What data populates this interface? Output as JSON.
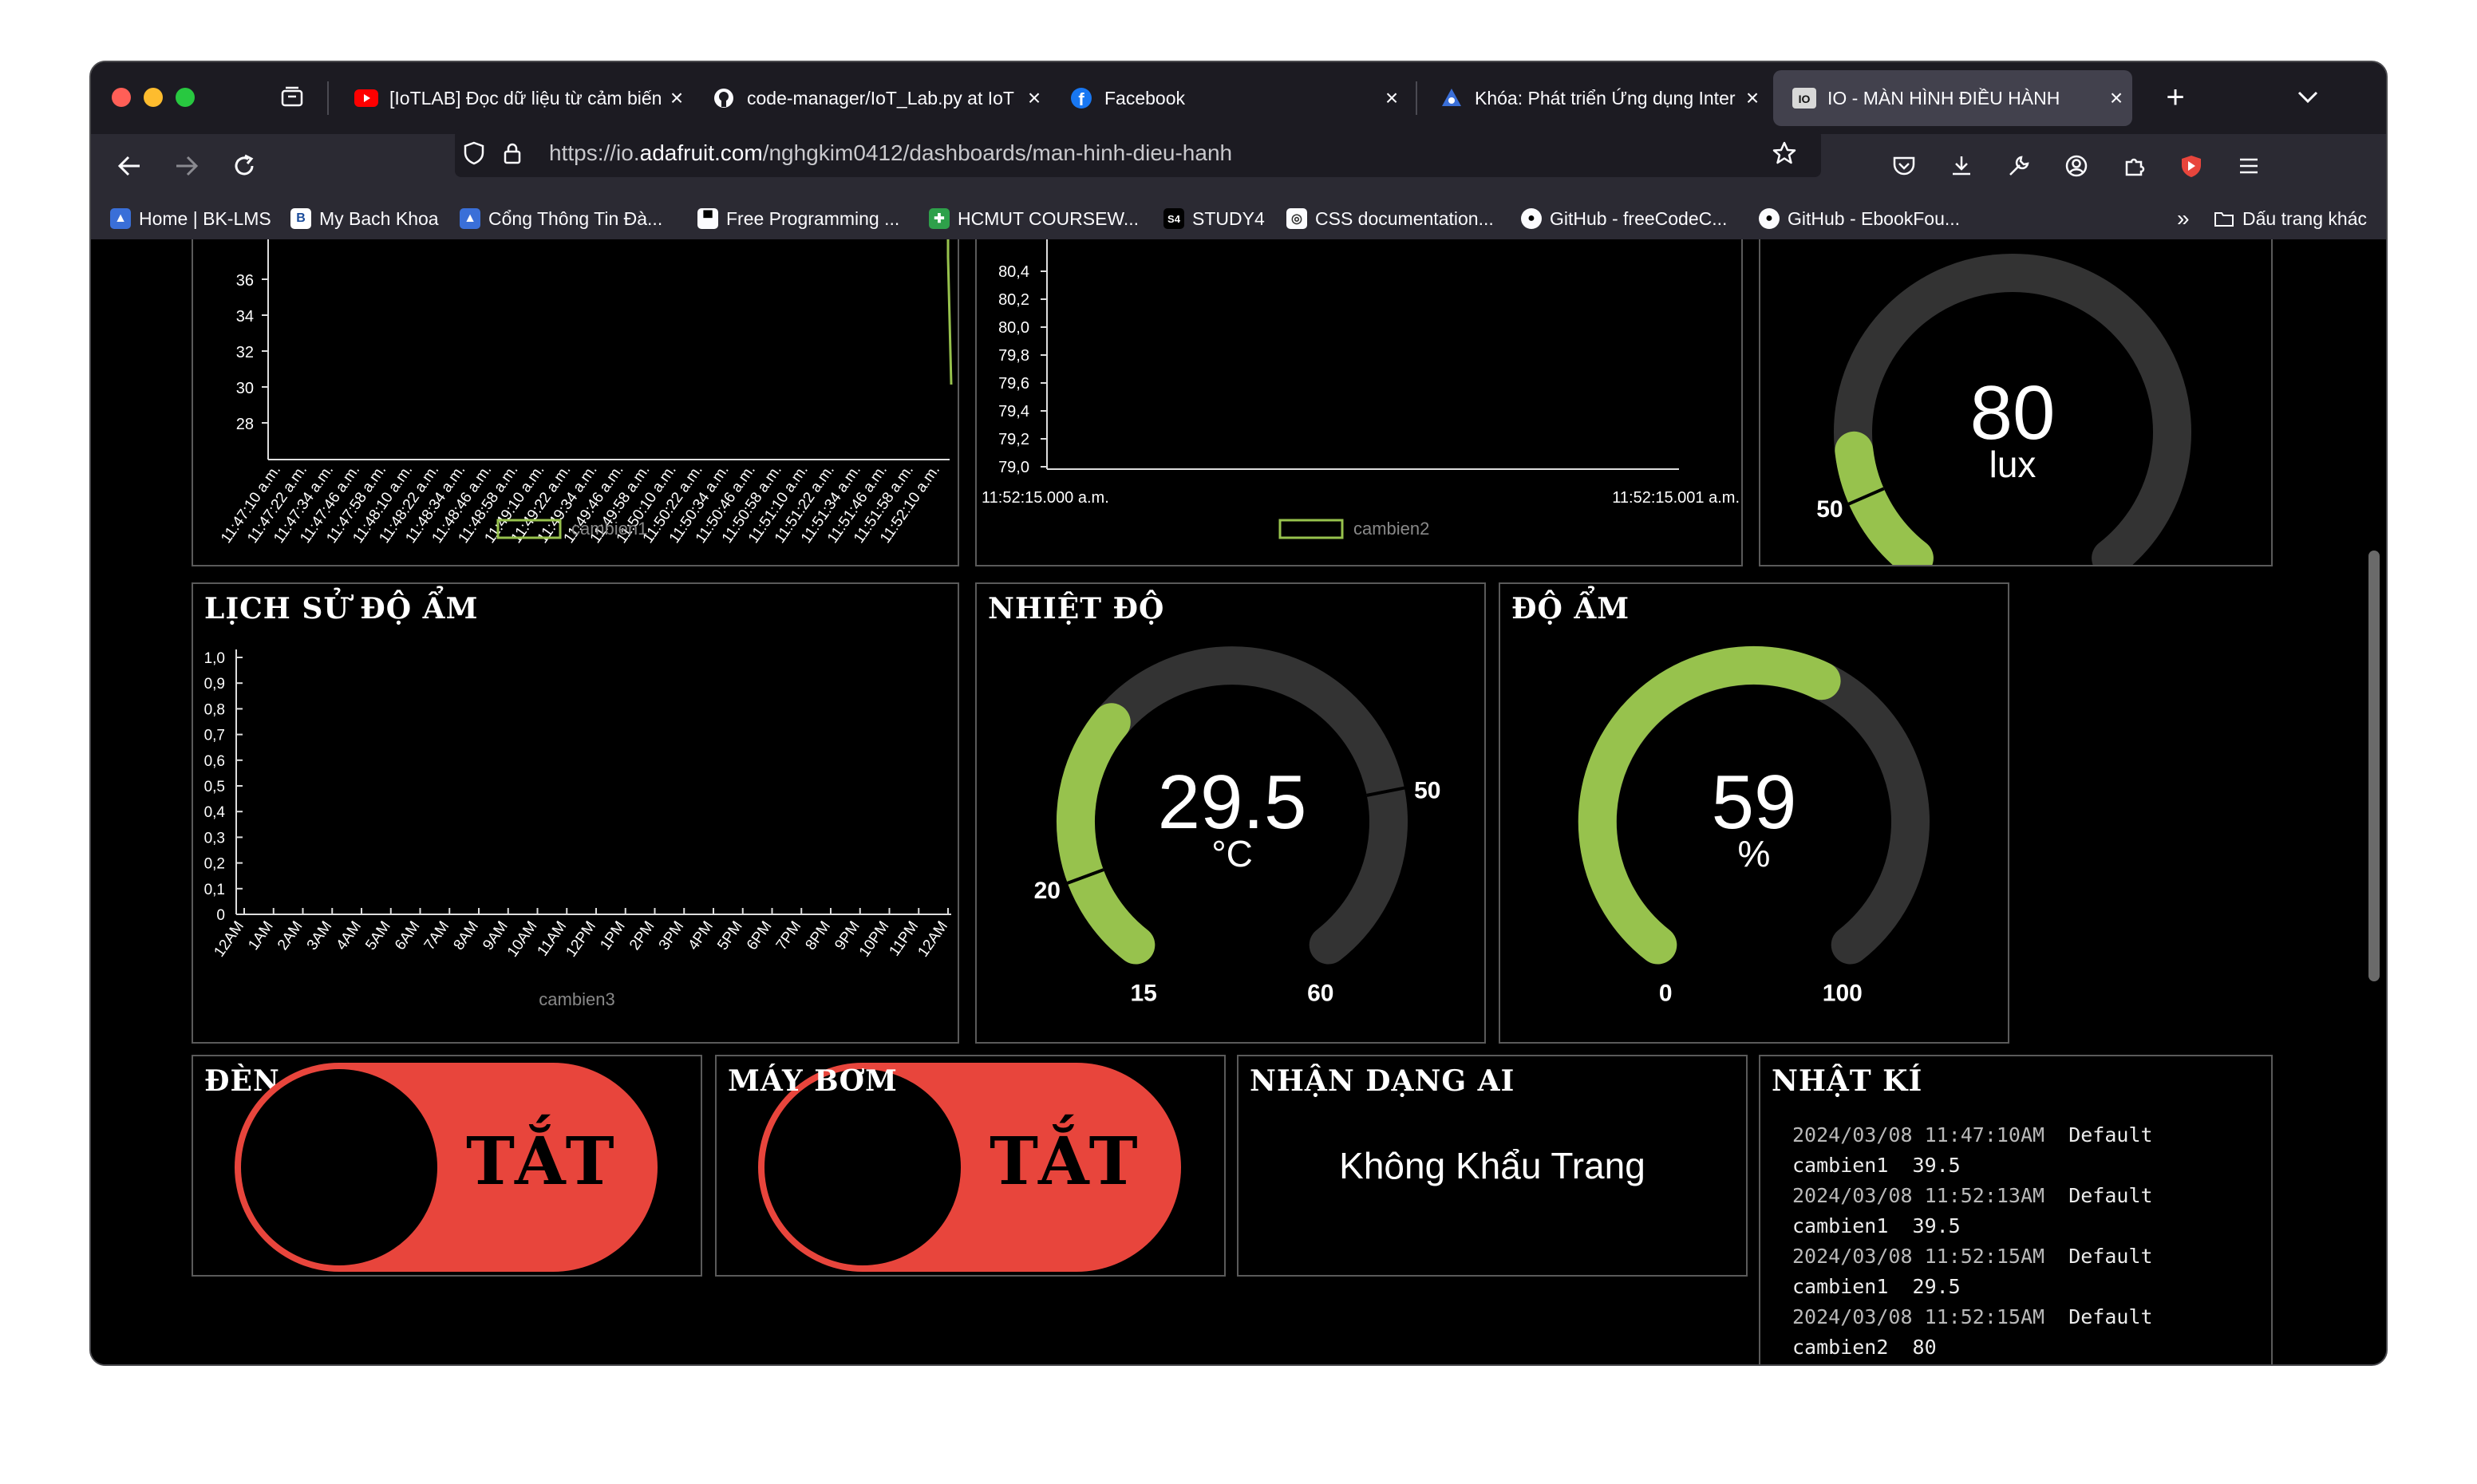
{
  "browser": {
    "tabs": [
      {
        "title": "[IoTLAB] Đọc dữ liệu từ cảm biến",
        "icon": "youtube-icon"
      },
      {
        "title": "code-manager/IoT_Lab.py at IoT",
        "icon": "github-icon"
      },
      {
        "title": "Facebook",
        "icon": "facebook-icon"
      },
      {
        "title": "Khóa: Phát triển Ứng dụng Internet",
        "icon": "bk-icon"
      },
      {
        "title": "IO - MÀN HÌNH ĐIỀU HÀNH",
        "icon": "adafruit-io-icon",
        "active": true
      }
    ],
    "url_prefix": "https://io.",
    "url_domain": "adafruit.com",
    "url_path": "/nghgkim0412/dashboards/man-hinh-dieu-hanh",
    "bookmarks": [
      "Home | BK-LMS",
      "My Bach Khoa",
      "Cổng Thông Tin Đà...",
      "Free Programming ...",
      "HCMUT COURSEW...",
      "STUDY4",
      "CSS documentation...",
      "GitHub - freeCodeC...",
      "GitHub - EbookFou..."
    ],
    "other_bookmarks": "Dấu trang khác"
  },
  "dashboard": {
    "chart1": {
      "legend": "cambien1",
      "y_ticks": [
        "36",
        "34",
        "32",
        "30",
        "28"
      ],
      "x_ticks": [
        "11:47:10 a.m.",
        "11:47:22 a.m.",
        "11:47:34 a.m.",
        "11:47:46 a.m.",
        "11:47:58 a.m.",
        "11:48:10 a.m.",
        "11:48:22 a.m.",
        "11:48:34 a.m.",
        "11:48:46 a.m.",
        "11:48:58 a.m.",
        "11:49:10 a.m.",
        "11:49:22 a.m.",
        "11:49:34 a.m.",
        "11:49:46 a.m.",
        "11:49:58 a.m.",
        "11:50:10 a.m.",
        "11:50:22 a.m.",
        "11:50:34 a.m.",
        "11:50:46 a.m.",
        "11:50:58 a.m.",
        "11:51:10 a.m.",
        "11:51:22 a.m.",
        "11:51:34 a.m.",
        "11:51:46 a.m.",
        "11:51:58 a.m.",
        "11:52:10 a.m."
      ]
    },
    "chart2": {
      "legend": "cambien2",
      "y_ticks": [
        "80,4",
        "80,2",
        "80,0",
        "79,8",
        "79,6",
        "79,4",
        "79,2",
        "79,0"
      ],
      "x_start": "11:52:15.000 a.m.",
      "x_end": "11:52:15.001 a.m."
    },
    "light_gauge": {
      "value": "80",
      "unit": "lux",
      "min": "0",
      "max": "500",
      "threshold": "50",
      "fraction": 0.16
    },
    "humidity_history": {
      "title": "LỊCH SỬ ĐỘ ẨM",
      "legend": "cambien3",
      "y_ticks": [
        "1,0",
        "0,9",
        "0,8",
        "0,7",
        "0,6",
        "0,5",
        "0,4",
        "0,3",
        "0,2",
        "0,1",
        "0"
      ],
      "x_ticks": [
        "12AM",
        "1AM",
        "2AM",
        "3AM",
        "4AM",
        "5AM",
        "6AM",
        "7AM",
        "8AM",
        "9AM",
        "10AM",
        "11AM",
        "12PM",
        "1PM",
        "2PM",
        "3PM",
        "4PM",
        "5PM",
        "6PM",
        "7PM",
        "8PM",
        "9PM",
        "10PM",
        "11PM",
        "12AM"
      ]
    },
    "temp_gauge": {
      "title": "NHIỆT ĐỘ",
      "value": "29.5",
      "unit": "°C",
      "min": "15",
      "max": "60",
      "low": "20",
      "high": "50",
      "fraction": 0.3222
    },
    "hum_gauge": {
      "title": "ĐỘ ẨM",
      "value": "59",
      "unit": "%",
      "min": "0",
      "max": "100",
      "fraction": 0.59
    },
    "toggle_light": {
      "title": "ĐÈN",
      "state": "TẮT"
    },
    "toggle_pump": {
      "title": "MÁY BƠM",
      "state": "TẮT"
    },
    "ai": {
      "title": "NHẬN DẠNG AI",
      "text": "Không Khẩu Trang"
    },
    "log": {
      "title": "NHẬT KÍ",
      "entries": [
        {
          "time": "2024/03/08 11:47:10AM",
          "group": "Default",
          "feed": "cambien1",
          "value": "39.5"
        },
        {
          "time": "2024/03/08 11:52:13AM",
          "group": "Default",
          "feed": "cambien1",
          "value": "39.5"
        },
        {
          "time": "2024/03/08 11:52:15AM",
          "group": "Default",
          "feed": "cambien1",
          "value": "29.5"
        },
        {
          "time": "2024/03/08 11:52:15AM",
          "group": "Default",
          "feed": "cambien2",
          "value": "80"
        }
      ]
    }
  },
  "colors": {
    "accent": "#97c24d",
    "track": "#333333",
    "toggle_off": "#e8453c",
    "chrome": "#2b2a33"
  }
}
